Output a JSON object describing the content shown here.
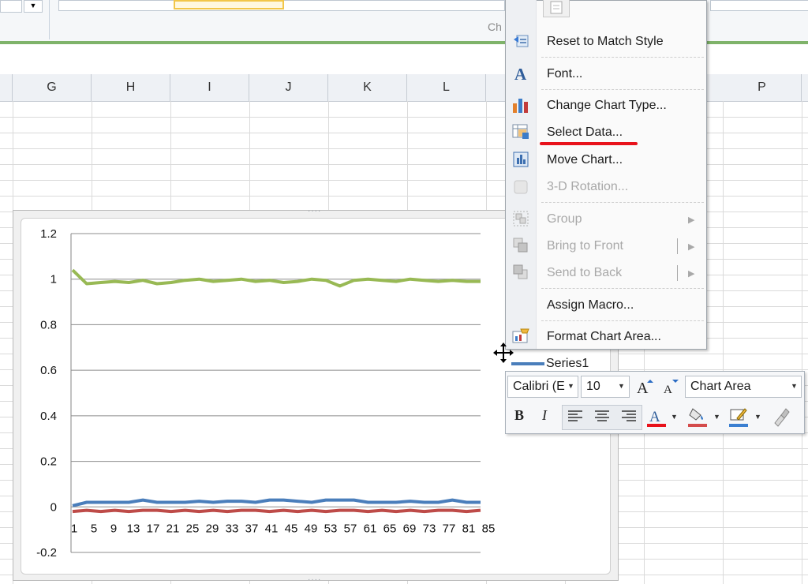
{
  "ribbon": {
    "group_label": "Ch"
  },
  "columns": [
    "G",
    "H",
    "I",
    "J",
    "K",
    "L",
    "P"
  ],
  "chart_data": {
    "type": "line",
    "ylim": [
      -0.2,
      1.2
    ],
    "yticks": [
      "1.2",
      "1",
      "0.8",
      "0.6",
      "0.4",
      "0.2",
      "0",
      "-0.2"
    ],
    "xticks": [
      "1",
      "5",
      "9",
      "13",
      "17",
      "21",
      "25",
      "29",
      "33",
      "37",
      "41",
      "45",
      "49",
      "53",
      "57",
      "61",
      "65",
      "69",
      "73",
      "77",
      "81",
      "85"
    ],
    "series": [
      {
        "name": "Series1",
        "color": "#4a7ebb",
        "values": [
          0.005,
          0.02,
          0.02,
          0.02,
          0.02,
          0.03,
          0.02,
          0.02,
          0.02,
          0.025,
          0.02,
          0.025,
          0.025,
          0.02,
          0.03,
          0.03,
          0.025,
          0.02,
          0.03,
          0.03,
          0.03,
          0.02,
          0.02,
          0.02,
          0.025,
          0.02,
          0.02,
          0.03,
          0.02,
          0.02
        ]
      },
      {
        "color": "#be4b48",
        "values": [
          -0.02,
          -0.015,
          -0.02,
          -0.015,
          -0.02,
          -0.015,
          -0.015,
          -0.02,
          -0.015,
          -0.02,
          -0.015,
          -0.02,
          -0.015,
          -0.015,
          -0.02,
          -0.015,
          -0.02,
          -0.015,
          -0.02,
          -0.015,
          -0.015,
          -0.02,
          -0.015,
          -0.02,
          -0.015,
          -0.02,
          -0.015,
          -0.015,
          -0.02,
          -0.015
        ]
      },
      {
        "color": "#98b954",
        "values": [
          1.04,
          0.98,
          0.985,
          0.99,
          0.985,
          0.995,
          0.98,
          0.985,
          0.995,
          1.0,
          0.99,
          0.995,
          1.0,
          0.99,
          0.995,
          0.985,
          0.99,
          1.0,
          0.995,
          0.97,
          0.995,
          1.0,
          0.995,
          0.99,
          1.0,
          0.995,
          0.99,
          0.995,
          0.99,
          0.99
        ]
      }
    ]
  },
  "legend": {
    "series1_label": "Series1"
  },
  "context_menu": {
    "items": [
      {
        "label": "Reset to Match Style",
        "icon": "reset-style-icon",
        "enabled": true
      },
      {
        "label": "Font...",
        "icon": "font-a-icon",
        "enabled": true
      },
      {
        "label": "Change Chart Type...",
        "icon": "bar-chart-icon",
        "enabled": true
      },
      {
        "label": "Select Data...",
        "icon": "select-data-icon",
        "enabled": true
      },
      {
        "label": "Move Chart...",
        "icon": "move-chart-icon",
        "enabled": true
      },
      {
        "label": "3-D Rotation...",
        "icon": "rotation-3d-icon",
        "enabled": false
      },
      {
        "label": "Group",
        "icon": "group-icon",
        "enabled": false
      },
      {
        "label": "Bring to Front",
        "icon": "bring-front-icon",
        "enabled": false
      },
      {
        "label": "Send to Back",
        "icon": "send-back-icon",
        "enabled": false
      },
      {
        "label": "Assign Macro...",
        "icon": "",
        "enabled": true
      },
      {
        "label": "Format Chart Area...",
        "icon": "format-chart-icon",
        "enabled": true
      }
    ]
  },
  "mini_toolbar": {
    "font_name": "Calibri (E",
    "font_size": "10",
    "element_selector": "Chart Area",
    "bold": "B",
    "italic": "I",
    "font_color": "#e8121b",
    "fill_color": "#d44c4c",
    "outline_color": "#3b7fd1"
  },
  "annotation": {
    "underline_color": "#e8121b"
  }
}
